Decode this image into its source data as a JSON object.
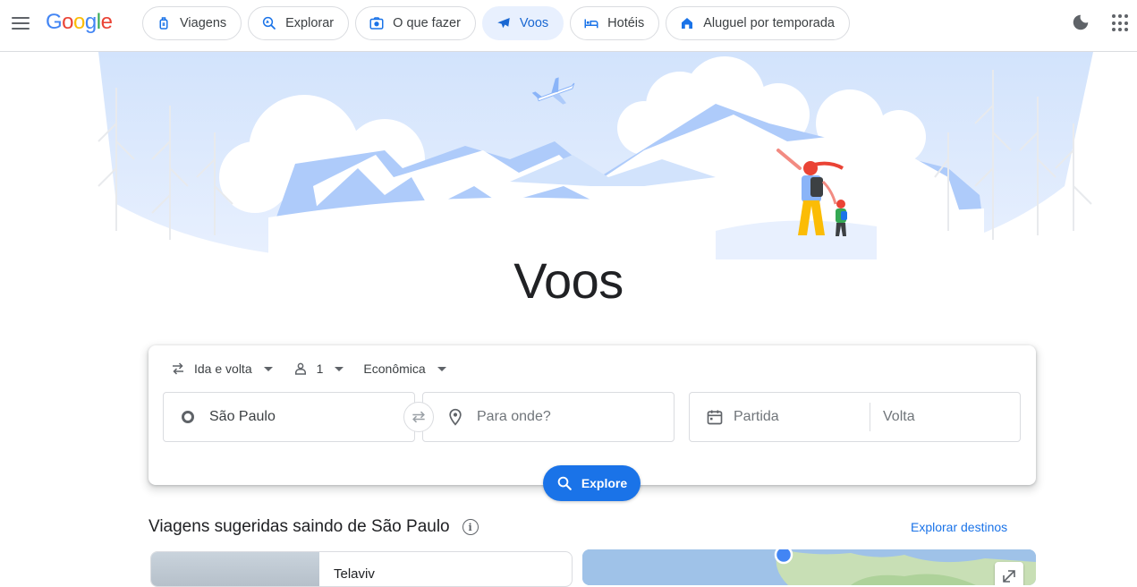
{
  "header": {
    "logo": [
      "G",
      "o",
      "o",
      "g",
      "l",
      "e"
    ],
    "tabs": [
      {
        "label": "Viagens",
        "icon": "luggage-icon"
      },
      {
        "label": "Explorar",
        "icon": "explore-icon"
      },
      {
        "label": "O que fazer",
        "icon": "camera-icon"
      },
      {
        "label": "Voos",
        "icon": "plane-icon",
        "active": true
      },
      {
        "label": "Hotéis",
        "icon": "bed-icon"
      },
      {
        "label": "Aluguel por temporada",
        "icon": "house-icon"
      }
    ]
  },
  "page_title": "Voos",
  "search": {
    "trip_type": "Ida e volta",
    "passengers": "1",
    "cabin_class": "Econômica",
    "origin": "São Paulo",
    "destination_placeholder": "Para onde?",
    "departure_placeholder": "Partida",
    "return_placeholder": "Volta",
    "explore_label": "Explore"
  },
  "suggested": {
    "title": "Viagens sugeridas saindo de São Paulo",
    "info_icon": "i",
    "explore_link": "Explorar destinos",
    "first_destination": "Telaviv"
  },
  "colors": {
    "accent": "#1a73e8",
    "active_tab_bg": "#e8f0fe",
    "active_tab_text": "#1967d2"
  }
}
